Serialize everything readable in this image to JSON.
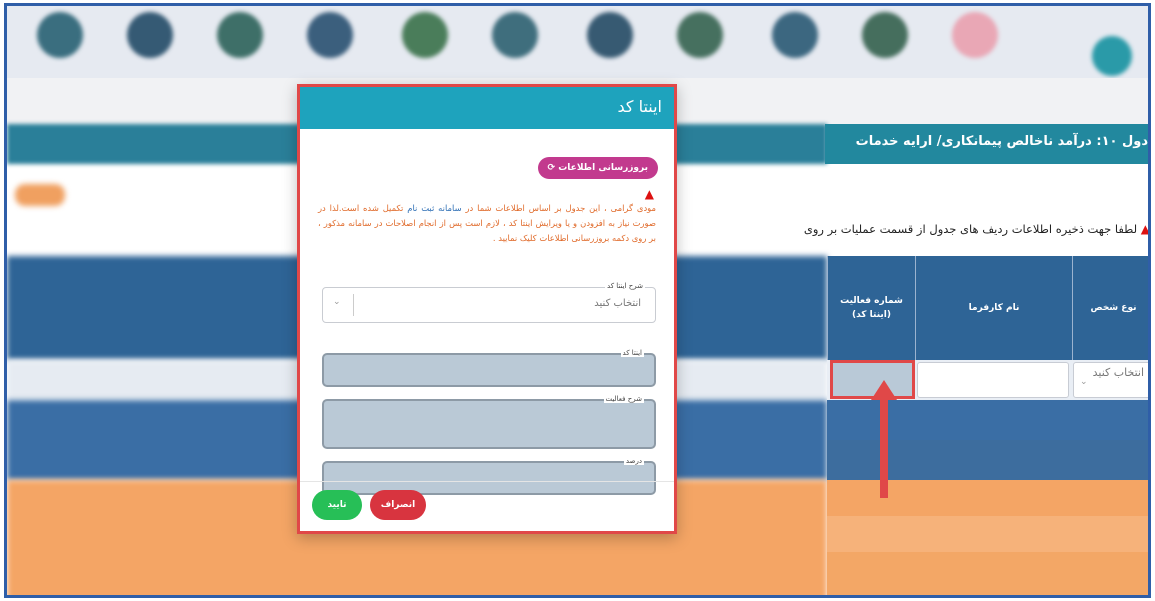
{
  "modal": {
    "title": "اینتا کد",
    "refresh_label": "بروزرسانی اطلاعات",
    "notice_part1": "مودی گرامی ، این جدول بر اساس اطلاعات شما در ",
    "notice_highlight": "سامانه ثبت نام",
    "notice_part2": " تکمیل شده است.لذا در صورت نیاز به افزودن و یا ویرایش اینتا کد ، لازم است پس از انجام اصلاحات در سامانه مذکور ، بر روی دکمه بروزرسانی اطلاعات کلیک نمایید .",
    "fields": {
      "description_select_label": "شرح اینتا کد",
      "description_select_value": "انتخاب کنید",
      "code_label": "اینتا کد",
      "activity_label": "شرح فعالیت",
      "percent_label": "درصد"
    },
    "confirm_label": "تایید",
    "cancel_label": "انصراف"
  },
  "panel": {
    "header": "دول ۱۰: درآمد ناخالص پیمانکاری/ ارایه خدمات",
    "warning": "لطفا جهت ذخیره اطلاعات ردیف های جدول از قسمت عملیات بر روی",
    "columns": {
      "person_type": "نوع شخص",
      "employer_name": "نام کارفرما",
      "activity_number": "شماره فعالیت (اینتا کد)"
    },
    "row": {
      "person_type_value": "انتخاب کنید"
    }
  },
  "colors": {
    "modal_header": "#1ea3bd",
    "highlight_border": "#e04848",
    "confirm": "#27bf57",
    "cancel": "#d8343f",
    "table_header": "#2e6496",
    "orange_rows": "#f4a565"
  },
  "icons": [
    "refresh-icon",
    "warning-icon",
    "chevron-down-icon",
    "arrow-up-icon"
  ]
}
